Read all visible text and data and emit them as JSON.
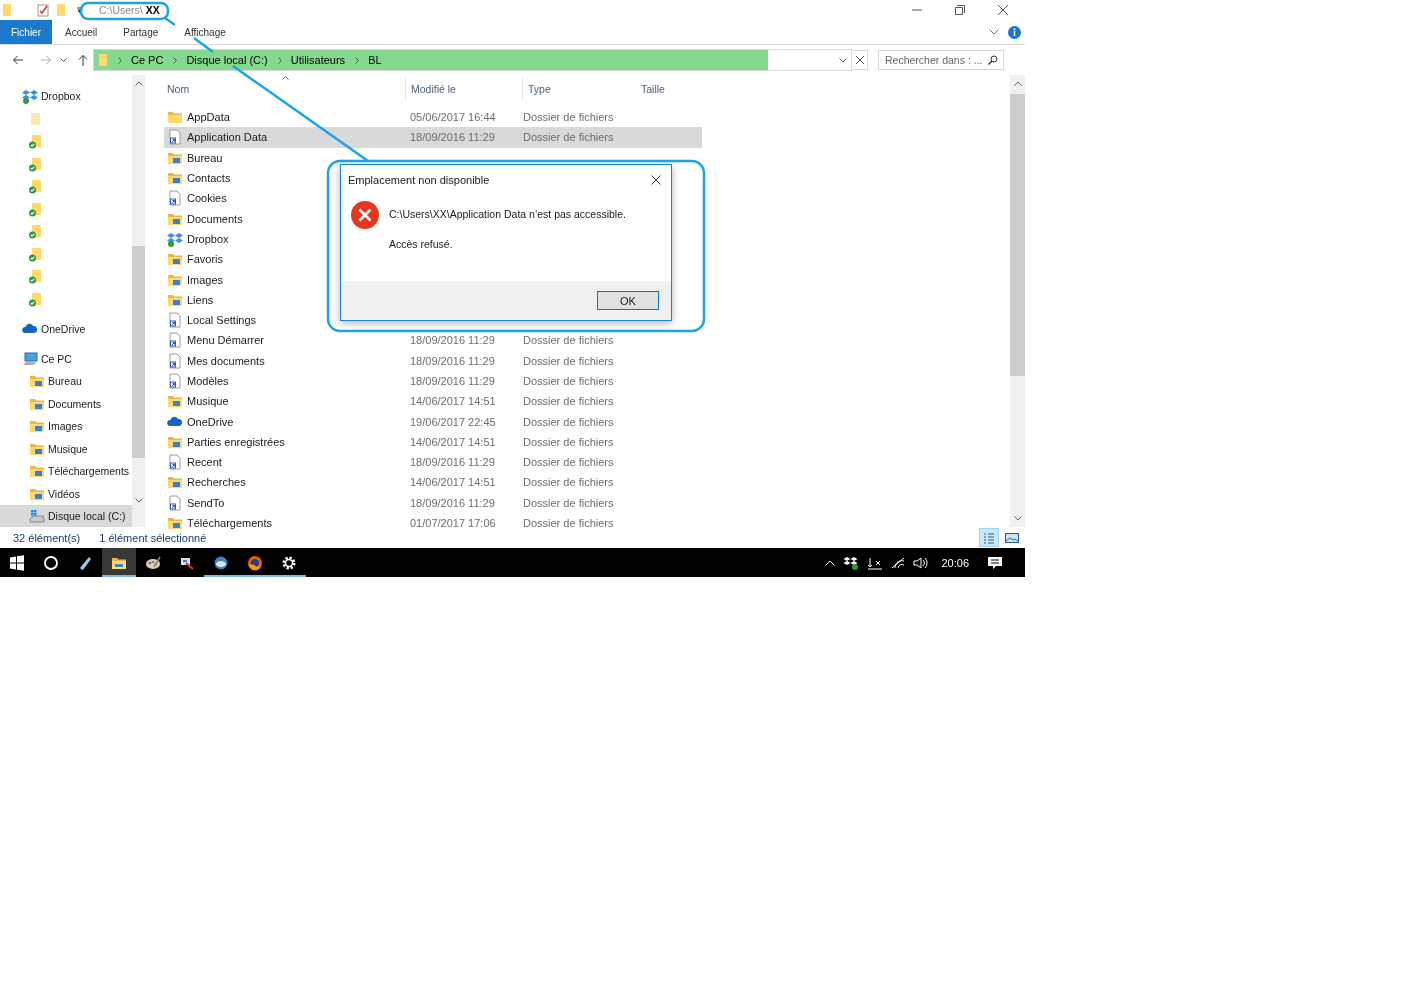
{
  "window": {
    "title": "C:\\Users\\ **XX**"
  },
  "ribbon": {
    "tabs": [
      {
        "label": "Fichier",
        "selected": true
      },
      {
        "label": "Accueil",
        "selected": false
      },
      {
        "label": "Partage",
        "selected": false
      },
      {
        "label": "Affichage",
        "selected": false
      }
    ]
  },
  "address_bar": {
    "crumbs": [
      "Ce PC",
      "Disque local (C:)",
      "Utilisateurs",
      "BL"
    ],
    "level": 0.89,
    "search": {
      "placeholder": "Rechercher dans : ..."
    }
  },
  "navigation": {
    "items": [
      {
        "label": "Dropbox",
        "kind": "dropbox",
        "selected": false,
        "children": [
          {
            "kind": "folder",
            "synced": false,
            "selected": false
          },
          {
            "kind": "folder",
            "synced": true,
            "selected": false
          },
          {
            "kind": "folder",
            "synced": true,
            "selected": false
          },
          {
            "kind": "folder",
            "synced": true,
            "selected": false
          },
          {
            "kind": "folder",
            "synced": true,
            "selected": false
          },
          {
            "kind": "folder",
            "synced": true,
            "selected": false
          },
          {
            "kind": "folder",
            "synced": true,
            "selected": false
          },
          {
            "kind": "folder",
            "synced": true,
            "selected": false
          },
          {
            "kind": "folder",
            "synced": true,
            "selected": false
          }
        ]
      },
      {
        "label": "OneDrive",
        "kind": "cloud",
        "selected": false
      },
      {
        "label": "Ce PC",
        "kind": "pc",
        "selected": false,
        "children": [
          {
            "label": "Bureau",
            "kind": "special",
            "selected": false
          },
          {
            "label": "Documents",
            "kind": "special",
            "selected": false
          },
          {
            "label": "Images",
            "kind": "special",
            "selected": false
          },
          {
            "label": "Musique",
            "kind": "special",
            "selected": false
          },
          {
            "label": "Téléchargements",
            "kind": "special",
            "selected": false
          },
          {
            "label": "Vidéos",
            "kind": "special",
            "selected": false
          },
          {
            "label": "Disque local (C:)",
            "kind": "drive",
            "selected": true
          }
        ]
      }
    ]
  },
  "file_list": {
    "columns": [
      "Nom",
      "Modifié le",
      "Type",
      "Taille"
    ],
    "rows": [
      {
        "name": "AppData",
        "kind": "folder",
        "modified": "05/06/2017 16:44",
        "type": "Dossier de fichiers",
        "selected": false
      },
      {
        "name": "Application Data",
        "kind": "shortcut",
        "modified": "18/09/2016 11:29",
        "type": "Dossier de fichiers",
        "selected": true
      },
      {
        "name": "Bureau",
        "kind": "special",
        "selected": false
      },
      {
        "name": "Contacts",
        "kind": "special",
        "selected": false
      },
      {
        "name": "Cookies",
        "kind": "shortcut",
        "selected": false
      },
      {
        "name": "Documents",
        "kind": "special",
        "selected": false
      },
      {
        "name": "Dropbox",
        "kind": "dropbox",
        "selected": false
      },
      {
        "name": "Favoris",
        "kind": "special",
        "selected": false
      },
      {
        "name": "Images",
        "kind": "special",
        "selected": false
      },
      {
        "name": "Liens",
        "kind": "special",
        "selected": false
      },
      {
        "name": "Local Settings",
        "kind": "shortcut",
        "selected": false
      },
      {
        "name": "Menu Démarrer",
        "kind": "shortcut",
        "modified": "18/09/2016 11:29",
        "type": "Dossier de fichiers",
        "selected": false
      },
      {
        "name": "Mes documents",
        "kind": "shortcut",
        "modified": "18/09/2016 11:29",
        "type": "Dossier de fichiers",
        "selected": false
      },
      {
        "name": "Modèles",
        "kind": "shortcut",
        "modified": "18/09/2016 11:29",
        "type": "Dossier de fichiers",
        "selected": false
      },
      {
        "name": "Musique",
        "kind": "special",
        "modified": "14/06/2017 14:51",
        "type": "Dossier de fichiers",
        "selected": false
      },
      {
        "name": "OneDrive",
        "kind": "cloud",
        "modified": "19/06/2017 22:45",
        "type": "Dossier de fichiers",
        "selected": false
      },
      {
        "name": "Parties enregistrées",
        "kind": "special",
        "modified": "14/06/2017 14:51",
        "type": "Dossier de fichiers",
        "selected": false
      },
      {
        "name": "Recent",
        "kind": "shortcut",
        "modified": "18/09/2016 11:29",
        "type": "Dossier de fichiers",
        "selected": false
      },
      {
        "name": "Recherches",
        "kind": "special",
        "modified": "14/06/2017 14:51",
        "type": "Dossier de fichiers",
        "selected": false
      },
      {
        "name": "SendTo",
        "kind": "shortcut",
        "modified": "18/09/2016 11:29",
        "type": "Dossier de fichiers",
        "selected": false
      },
      {
        "name": "Téléchargements",
        "kind": "special",
        "modified": "01/07/2017 17:06",
        "type": "Dossier de fichiers",
        "selected": false
      }
    ]
  },
  "dialog": {
    "title": "Emplacement non disponible",
    "message": "C:\\Users\\XX\\Application Data n’est pas accessible.",
    "detail": "Accès refusé.",
    "button": "OK"
  },
  "status_bar": {
    "count": "32 élément(s)",
    "selection": "1 élément sélectionné",
    "views": [
      {
        "kind": "details",
        "selected": true
      },
      {
        "kind": "tiles",
        "selected": false
      }
    ]
  },
  "taskbar": {
    "items": [
      {
        "kind": "start",
        "running": false,
        "active": false
      },
      {
        "kind": "search",
        "running": false,
        "active": false
      },
      {
        "kind": "app",
        "running": false,
        "active": false
      },
      {
        "kind": "explorer",
        "running": true,
        "active": true
      },
      {
        "kind": "paint",
        "running": false,
        "active": false
      },
      {
        "kind": "tool",
        "running": false,
        "active": false
      },
      {
        "kind": "mail",
        "running": true,
        "active": false
      },
      {
        "kind": "firefox",
        "running": true,
        "active": false
      },
      {
        "kind": "settings",
        "running": true,
        "active": false
      }
    ],
    "clock": "20:06"
  }
}
